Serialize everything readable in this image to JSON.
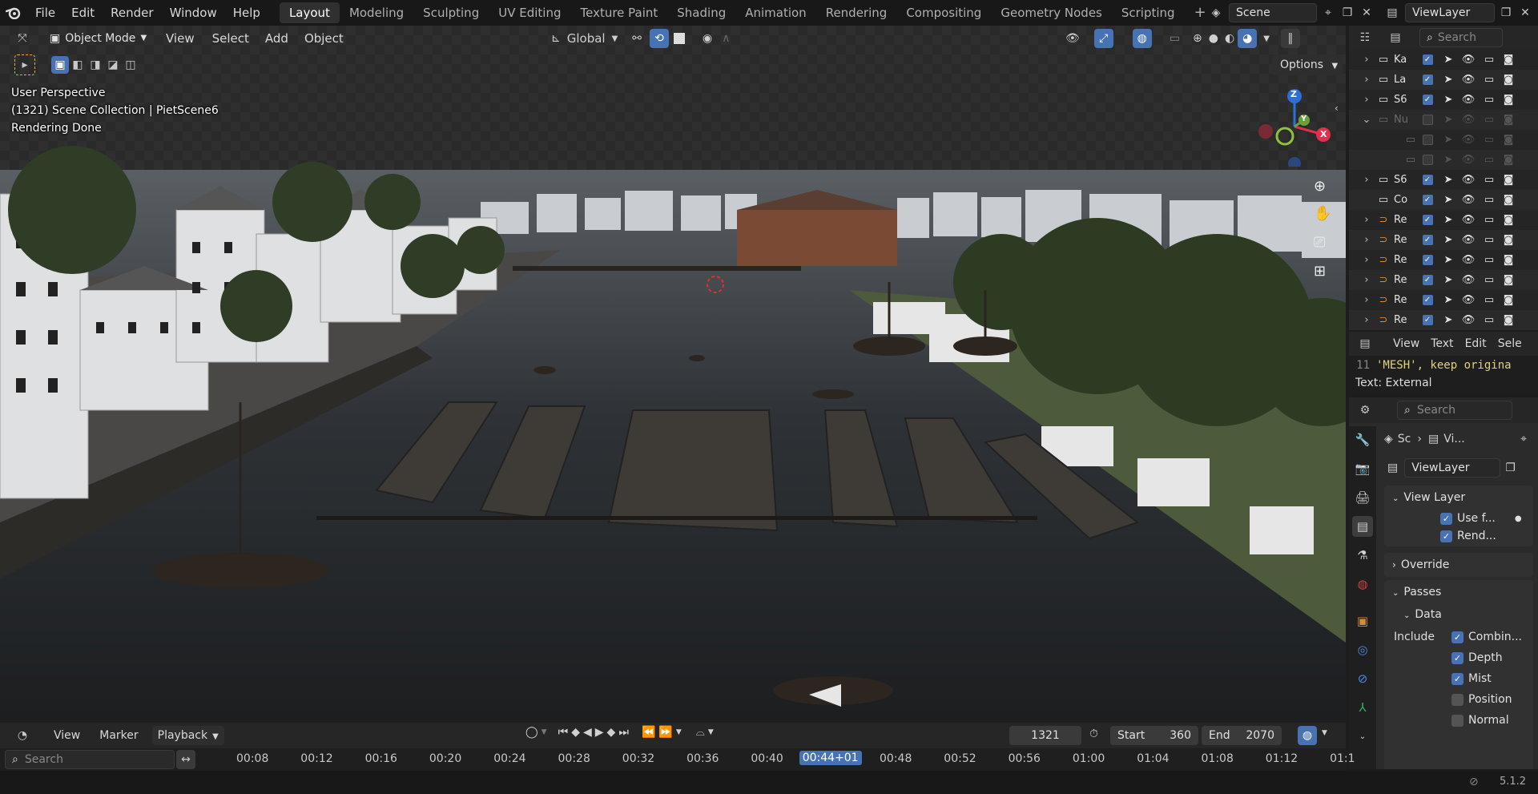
{
  "topbar": {
    "logo": "blender-logo",
    "menus": [
      "File",
      "Edit",
      "Render",
      "Window",
      "Help"
    ],
    "workspaces": [
      "Layout",
      "Modeling",
      "Sculpting",
      "UV Editing",
      "Texture Paint",
      "Shading",
      "Animation",
      "Rendering",
      "Compositing",
      "Geometry Nodes",
      "Scripting"
    ],
    "active_workspace": "Layout",
    "add_tab": "+",
    "scene": "Scene",
    "view_layer": "ViewLayer"
  },
  "viewport": {
    "mode": "Object Mode",
    "menus": [
      "View",
      "Select",
      "Add",
      "Object"
    ],
    "orientation": "Global",
    "options": "Options",
    "overlay": {
      "line1": "User Perspective",
      "line2": "(1321) Scene Collection | PietScene6",
      "line3": "Rendering Done"
    },
    "gizmo": {
      "z": "Z",
      "y": "Y",
      "x": "X"
    }
  },
  "outliner": {
    "search_placeholder": "Search",
    "rows": [
      {
        "name": "Ka",
        "expand": "›",
        "enabled": true,
        "icon": "collection-icon"
      },
      {
        "name": "La",
        "expand": "›",
        "enabled": true,
        "icon": "collection-icon"
      },
      {
        "name": "S6",
        "expand": "›",
        "enabled": true,
        "icon": "collection-icon"
      },
      {
        "name": "Nu",
        "expand": "⌄",
        "enabled": false,
        "icon": "collection-icon"
      },
      {
        "name": "",
        "expand": "",
        "enabled": false,
        "icon": "collection-icon"
      },
      {
        "name": "",
        "expand": "",
        "enabled": false,
        "icon": "collection-icon"
      },
      {
        "name": "S6",
        "expand": "›",
        "enabled": true,
        "icon": "collection-icon"
      },
      {
        "name": "Co",
        "expand": "",
        "enabled": true,
        "icon": "collection-icon"
      },
      {
        "name": "Re",
        "expand": "›",
        "enabled": true,
        "icon": "rope-icon"
      },
      {
        "name": "Re",
        "expand": "›",
        "enabled": true,
        "icon": "rope-icon"
      },
      {
        "name": "Re",
        "expand": "›",
        "enabled": true,
        "icon": "rope-icon"
      },
      {
        "name": "Re",
        "expand": "›",
        "enabled": true,
        "icon": "rope-icon"
      },
      {
        "name": "Re",
        "expand": "›",
        "enabled": true,
        "icon": "rope-icon"
      },
      {
        "name": "Re",
        "expand": "›",
        "enabled": true,
        "icon": "rope-icon"
      }
    ]
  },
  "text_editor": {
    "menus": [
      "View",
      "Text",
      "Edit",
      "Sele"
    ],
    "line_number": "11",
    "line_text": "'MESH', keep origina",
    "status": "Text: External"
  },
  "properties": {
    "search_placeholder": "Search",
    "breadcrumb": [
      "Sc",
      "Vi..."
    ],
    "view_layer_name": "ViewLayer",
    "panels": {
      "view_layer": "View Layer",
      "use_f": "Use f...",
      "rend": "Rend...",
      "override": "Override",
      "passes": "Passes",
      "data": "Data",
      "include": "Include"
    },
    "passes": [
      {
        "label": "Combin...",
        "checked": true
      },
      {
        "label": "Depth",
        "checked": true
      },
      {
        "label": "Mist",
        "checked": true
      },
      {
        "label": "Position",
        "checked": false
      },
      {
        "label": "Normal",
        "checked": false
      }
    ]
  },
  "timeline": {
    "menus": [
      "View",
      "Marker"
    ],
    "playback": "Playback",
    "current_frame": "1321",
    "start_label": "Start",
    "start": "360",
    "end_label": "End",
    "end": "2070",
    "search_placeholder": "Search",
    "ticks": [
      "00:08",
      "00:12",
      "00:16",
      "00:20",
      "00:24",
      "00:28",
      "00:32",
      "00:36",
      "00:40",
      "00:44+01",
      "00:48",
      "00:52",
      "00:56",
      "01:00",
      "01:04",
      "01:08",
      "01:12",
      "01:1"
    ],
    "current_tick": "00:44+01"
  },
  "status": {
    "version": "5.1.2"
  }
}
